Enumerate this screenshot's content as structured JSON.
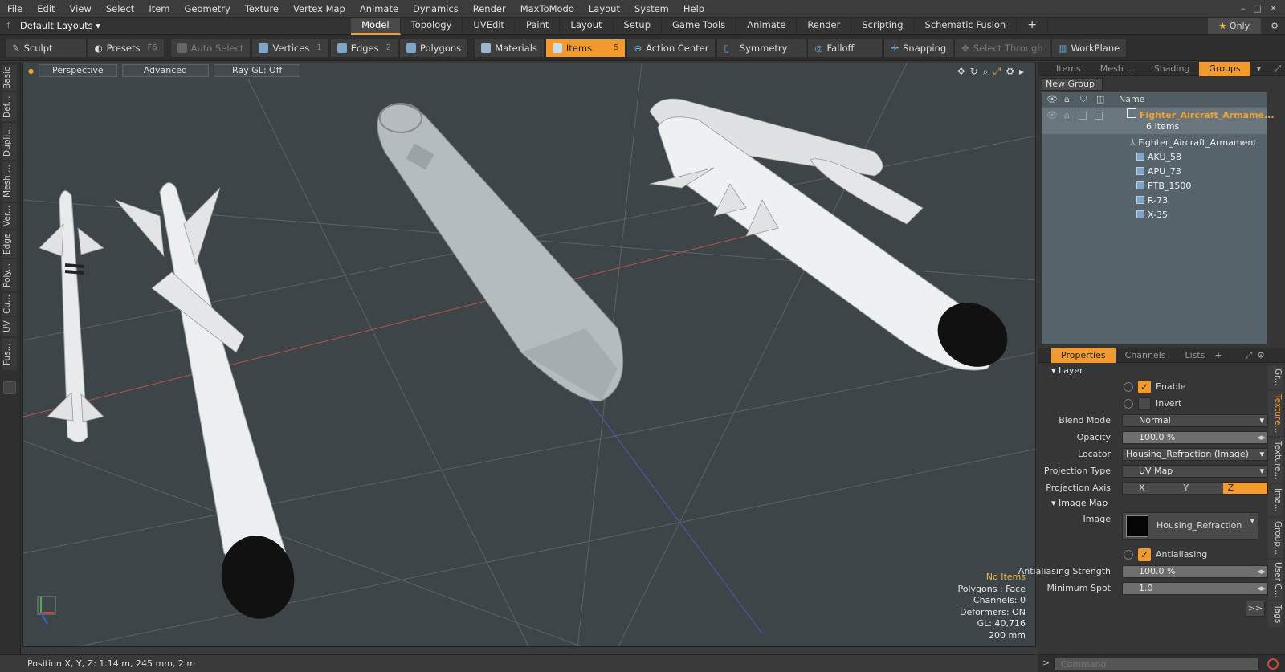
{
  "menu": [
    "File",
    "Edit",
    "View",
    "Select",
    "Item",
    "Geometry",
    "Texture",
    "Vertex Map",
    "Animate",
    "Dynamics",
    "Render",
    "MaxToModo",
    "Layout",
    "System",
    "Help"
  ],
  "layout_selector": "Default Layouts",
  "layout_tabs": [
    "Model",
    "Topology",
    "UVEdit",
    "Paint",
    "Layout",
    "Setup",
    "Game Tools",
    "Animate",
    "Render",
    "Scripting",
    "Schematic Fusion"
  ],
  "only_label": "Only",
  "toolbar": {
    "sculpt": "Sculpt",
    "presets": "Presets",
    "presets_key": "F6",
    "auto_select": "Auto Select",
    "vertices": "Vertices",
    "vertices_key": "1",
    "edges": "Edges",
    "edges_key": "2",
    "polygons": "Polygons",
    "materials": "Materials",
    "items": "Items",
    "items_key": "5",
    "action_center": "Action Center",
    "symmetry": "Symmetry",
    "falloff": "Falloff",
    "snapping": "Snapping",
    "select_through": "Select Through",
    "workplane": "WorkPlane"
  },
  "left_tabs": [
    "Basic",
    "Def...",
    "Dupli...",
    "Mesh ...",
    "Ver...",
    "Edge",
    "Poly...",
    "Cu...",
    "UV",
    "Fus..."
  ],
  "viewport": {
    "perspective": "Perspective",
    "advanced": "Advanced",
    "raygl": "Ray GL: Off",
    "info": {
      "items": "No Items",
      "polygons": "Polygons : Face",
      "channels": "Channels: 0",
      "deformers": "Deformers: ON",
      "gl": "GL: 40,716",
      "scale": "200 mm"
    }
  },
  "status": "Position X, Y, Z:   1.14 m, 245 mm, 2 m",
  "top_panel": {
    "tabs": [
      "Items",
      "Mesh ...",
      "Shading",
      "Groups"
    ],
    "active_tab": "Groups",
    "new_group": "New Group",
    "col_name": "Name",
    "group_name": "Fighter_Aircraft_Armame...",
    "group_count": "6 Items",
    "children": [
      "Fighter_Aircraft_Armament",
      "AKU_58",
      "APU_73",
      "PTB_1500",
      "R-73",
      "X-35"
    ]
  },
  "props_panel": {
    "tabs": [
      "Properties",
      "Channels",
      "Lists"
    ],
    "layer_section": "Layer",
    "enable": "Enable",
    "invert": "Invert",
    "blend_mode_label": "Blend Mode",
    "blend_mode": "Normal",
    "opacity_label": "Opacity",
    "opacity": "100.0 %",
    "locator_label": "Locator",
    "locator": "Housing_Refraction (Image)",
    "projection_type_label": "Projection Type",
    "projection_type": "UV Map",
    "projection_axis_label": "Projection Axis",
    "axis_x": "X",
    "axis_y": "Y",
    "axis_z": "Z",
    "image_map_section": "Image Map",
    "image_label": "Image",
    "image": "Housing_Refraction",
    "antialiasing": "Antialiasing",
    "aa_strength_label": "Antialiasing Strength",
    "aa_strength": "100.0 %",
    "min_spot_label": "Minimum Spot",
    "min_spot": "1.0",
    "more": ">>"
  },
  "right_tabs": [
    "Gr...",
    "Texture...",
    "Texture...",
    "Ima...",
    "Group...",
    "User C...",
    "Tags"
  ],
  "command_placeholder": "Command",
  "colors": {
    "accent": "#f29a2e",
    "viewport_bg": "#3d4549",
    "group_table_bg": "#58646c",
    "group_name": "#f0a030"
  }
}
